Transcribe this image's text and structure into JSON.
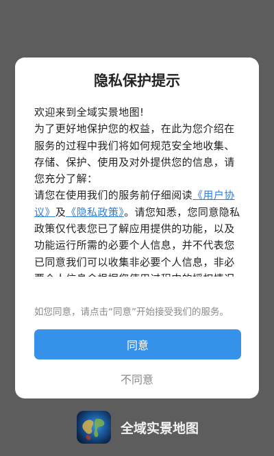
{
  "dialog": {
    "title": "隐私保护提示",
    "welcome": "欢迎来到全域实景地图!",
    "intro": "为了更好地保护您的权益，在此为您介绍在服务的过程中我们将如何规范安全地收集、存储、保护、使用及对外提供您的信息，请您充分了解：",
    "read_prefix": "请您在使用我们的服务前仔细阅读",
    "user_agreement_link": "《用户协议》",
    "and_text": "及",
    "privacy_policy_link": "《隐私政策》",
    "read_suffix": "。请您知悉，您同意隐私政策仅代表您已了解应用提供的功能，以及功能运行所需的必要个人信息，并不代表您已同意我们可以收集非必要个人信息，非必要个人信息会根据您使用过程中的授权情况单独征求",
    "hint": "如您同意，请点击“同意”开始接受我们的服务。",
    "agree_label": "同意",
    "disagree_label": "不同意"
  },
  "brand": {
    "app_name": "全域实景地图",
    "icon": "globe-map-icon"
  },
  "colors": {
    "link": "#2f7fd8",
    "primary_button": "#3592e8",
    "overlay": "#5d5d5d"
  }
}
